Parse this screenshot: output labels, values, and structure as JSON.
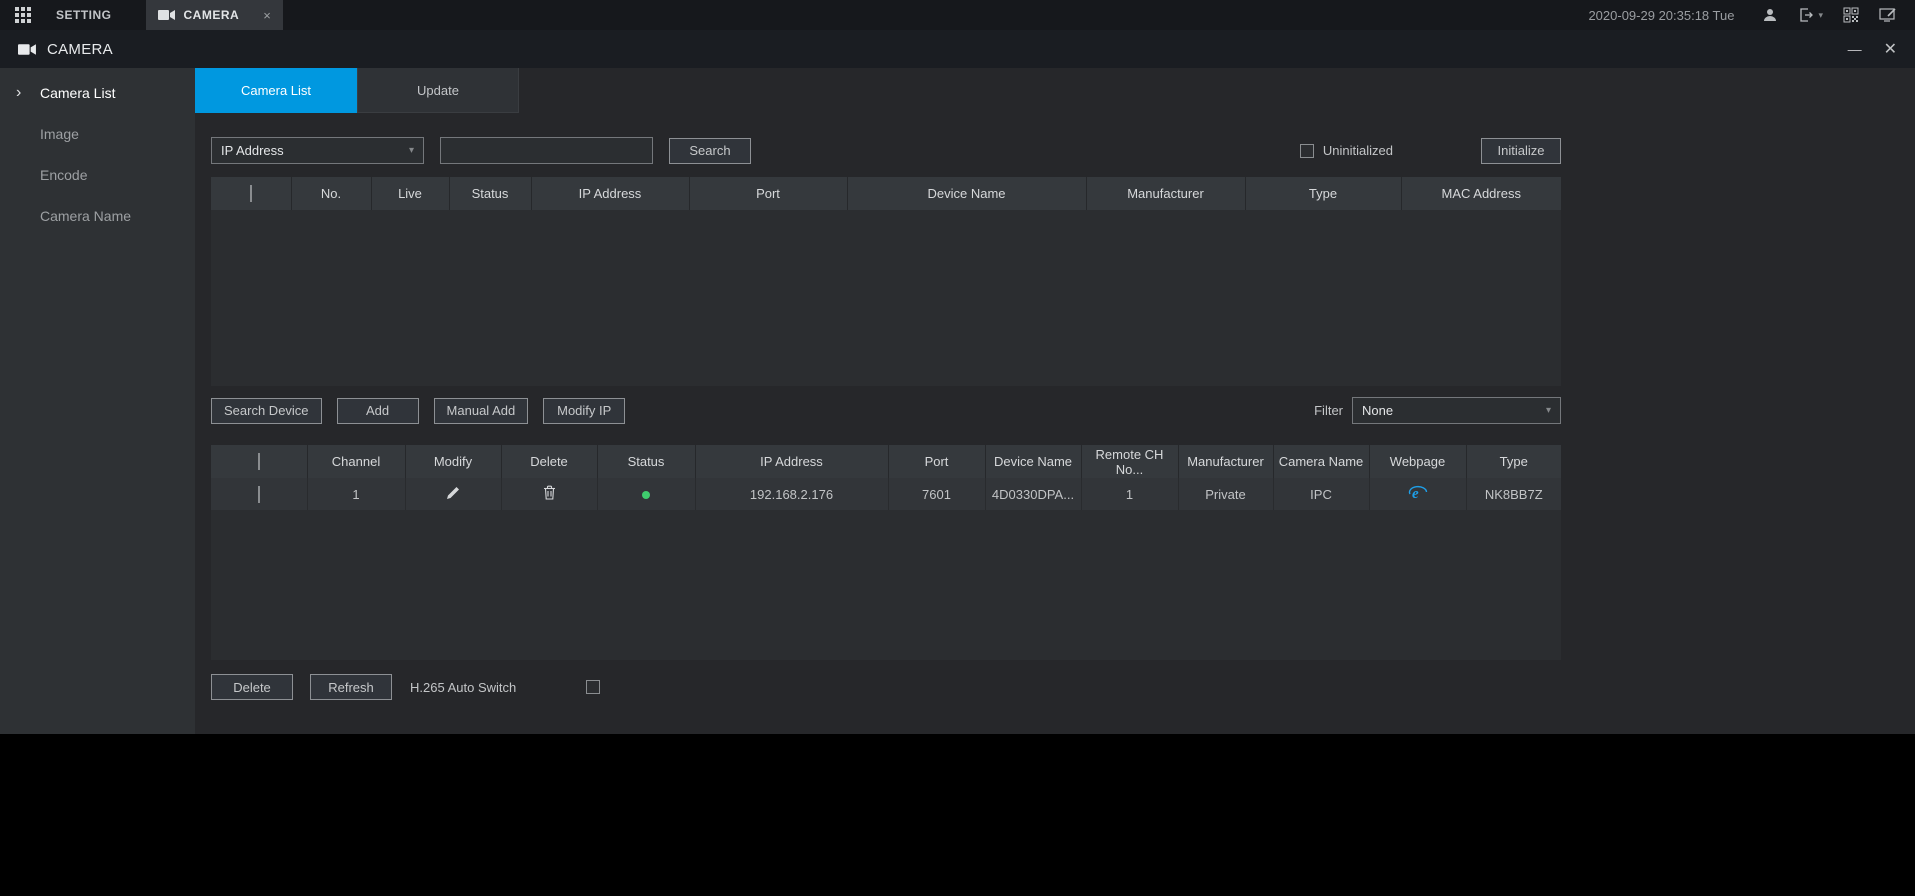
{
  "glyphs": {
    "chevron_down": "▾",
    "minimize": "—",
    "close": "✕",
    "tab_close": "×",
    "sidebar_arrow": "›"
  },
  "colors": {
    "accent": "#0098e0",
    "status_online": "#3fcc6e",
    "webpage_icon": "#1e9fe8"
  },
  "top_bar": {
    "setting_tab": "SETTING",
    "camera_tab": "CAMERA",
    "datetime": "2020-09-29 20:35:18 Tue"
  },
  "window": {
    "title": "CAMERA"
  },
  "sidebar": {
    "items": [
      {
        "label": "Camera List",
        "active": true
      },
      {
        "label": "Image",
        "active": false
      },
      {
        "label": "Encode",
        "active": false
      },
      {
        "label": "Camera Name",
        "active": false
      }
    ]
  },
  "main_tabs": {
    "camera_list": "Camera List",
    "update": "Update"
  },
  "search_section": {
    "filter_dropdown_value": "IP Address",
    "search_input_value": "",
    "search_button": "Search",
    "uninitialized_label": "Uninitialized",
    "initialize_button": "Initialize"
  },
  "device_table": {
    "headers": [
      "",
      "No.",
      "Live",
      "Status",
      "IP Address",
      "Port",
      "Device Name",
      "Manufacturer",
      "Type",
      "MAC Address"
    ],
    "rows": []
  },
  "actions": {
    "search_device_button": "Search Device",
    "add_button": "Add",
    "manual_add_button": "Manual Add",
    "modify_ip_button": "Modify IP",
    "filter_label": "Filter",
    "filter_value": "None"
  },
  "added_table": {
    "headers": [
      "",
      "Channel",
      "Modify",
      "Delete",
      "Status",
      "IP Address",
      "Port",
      "Device Name",
      "Remote CH No...",
      "Manufacturer",
      "Camera Name",
      "Webpage",
      "Type"
    ],
    "rows": [
      {
        "channel": "1",
        "status": "online",
        "ip_address": "192.168.2.176",
        "port": "7601",
        "device_name": "4D0330DPA...",
        "remote_ch_no": "1",
        "manufacturer": "Private",
        "camera_name": "IPC",
        "webpage": "ie",
        "type": "NK8BB7Z"
      }
    ]
  },
  "footer": {
    "delete_button": "Delete",
    "refresh_button": "Refresh",
    "h265_label": "H.265 Auto Switch"
  }
}
